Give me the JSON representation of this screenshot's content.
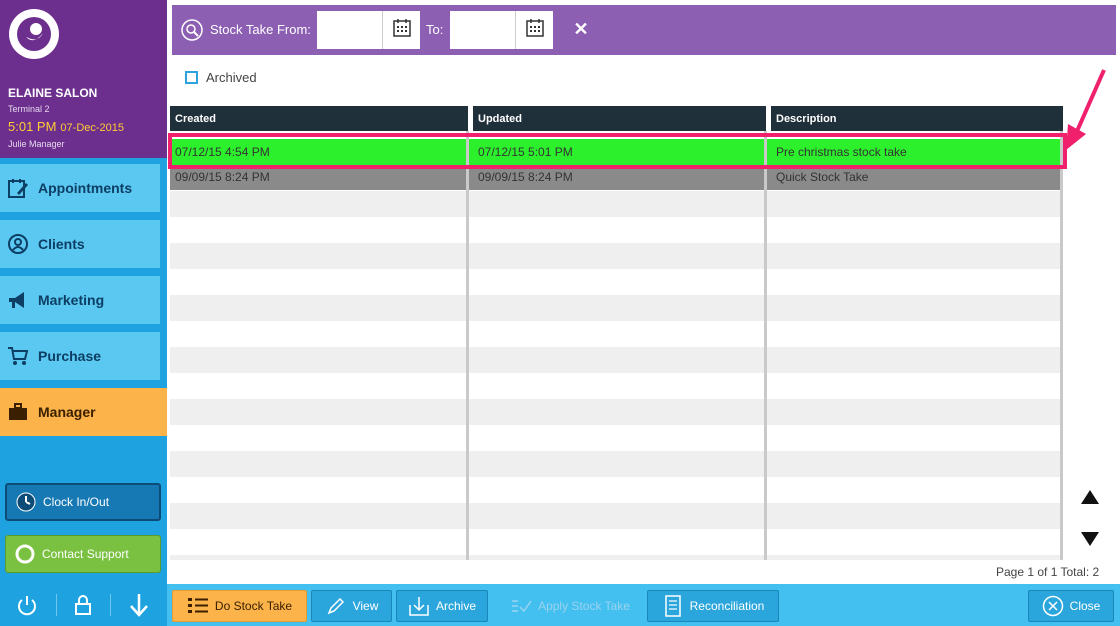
{
  "sidebar": {
    "salon_name": "ELAINE SALON",
    "terminal": "Terminal 2",
    "time": "5:01 PM",
    "date": "07-Dec-2015",
    "user": "Julie Manager",
    "nav": [
      {
        "label": "Appointments",
        "icon": "calendar-edit-icon"
      },
      {
        "label": "Clients",
        "icon": "clients-icon"
      },
      {
        "label": "Marketing",
        "icon": "megaphone-icon"
      },
      {
        "label": "Purchase",
        "icon": "cart-icon"
      },
      {
        "label": "Manager",
        "icon": "briefcase-icon",
        "active": true
      }
    ],
    "clock_label": "Clock In/Out",
    "support_label": "Contact Support",
    "bottom_icons": [
      "power-icon",
      "lock-icon",
      "download-arrow-icon"
    ]
  },
  "toolbar": {
    "from_label": "Stock Take From:",
    "to_label": "To:",
    "from_value": "",
    "to_value": ""
  },
  "archived_label": "Archived",
  "table": {
    "headers": [
      "Created",
      "Updated",
      "Description"
    ],
    "rows": [
      {
        "created": "07/12/15 4:54 PM",
        "updated": "07/12/15 5:01 PM",
        "description": "Pre christmas stock take",
        "state": "selected"
      },
      {
        "created": "09/09/15 8:24 PM",
        "updated": "09/09/15 8:24 PM",
        "description": "Quick Stock Take",
        "state": "normal"
      }
    ]
  },
  "page_info": "Page 1 of 1  Total: 2",
  "bottom_buttons": {
    "do_stock_take": "Do Stock Take",
    "view": "View",
    "archive": "Archive",
    "apply_stock_take": "Apply Stock Take",
    "reconciliation": "Reconciliation",
    "close": "Close"
  },
  "colors": {
    "sidebar_purple": "#6d2f8e",
    "toolbar_purple": "#8c5fb2",
    "selected_row": "#2cf02c",
    "highlight": "#f0206c",
    "active_nav": "#fbb34a"
  }
}
